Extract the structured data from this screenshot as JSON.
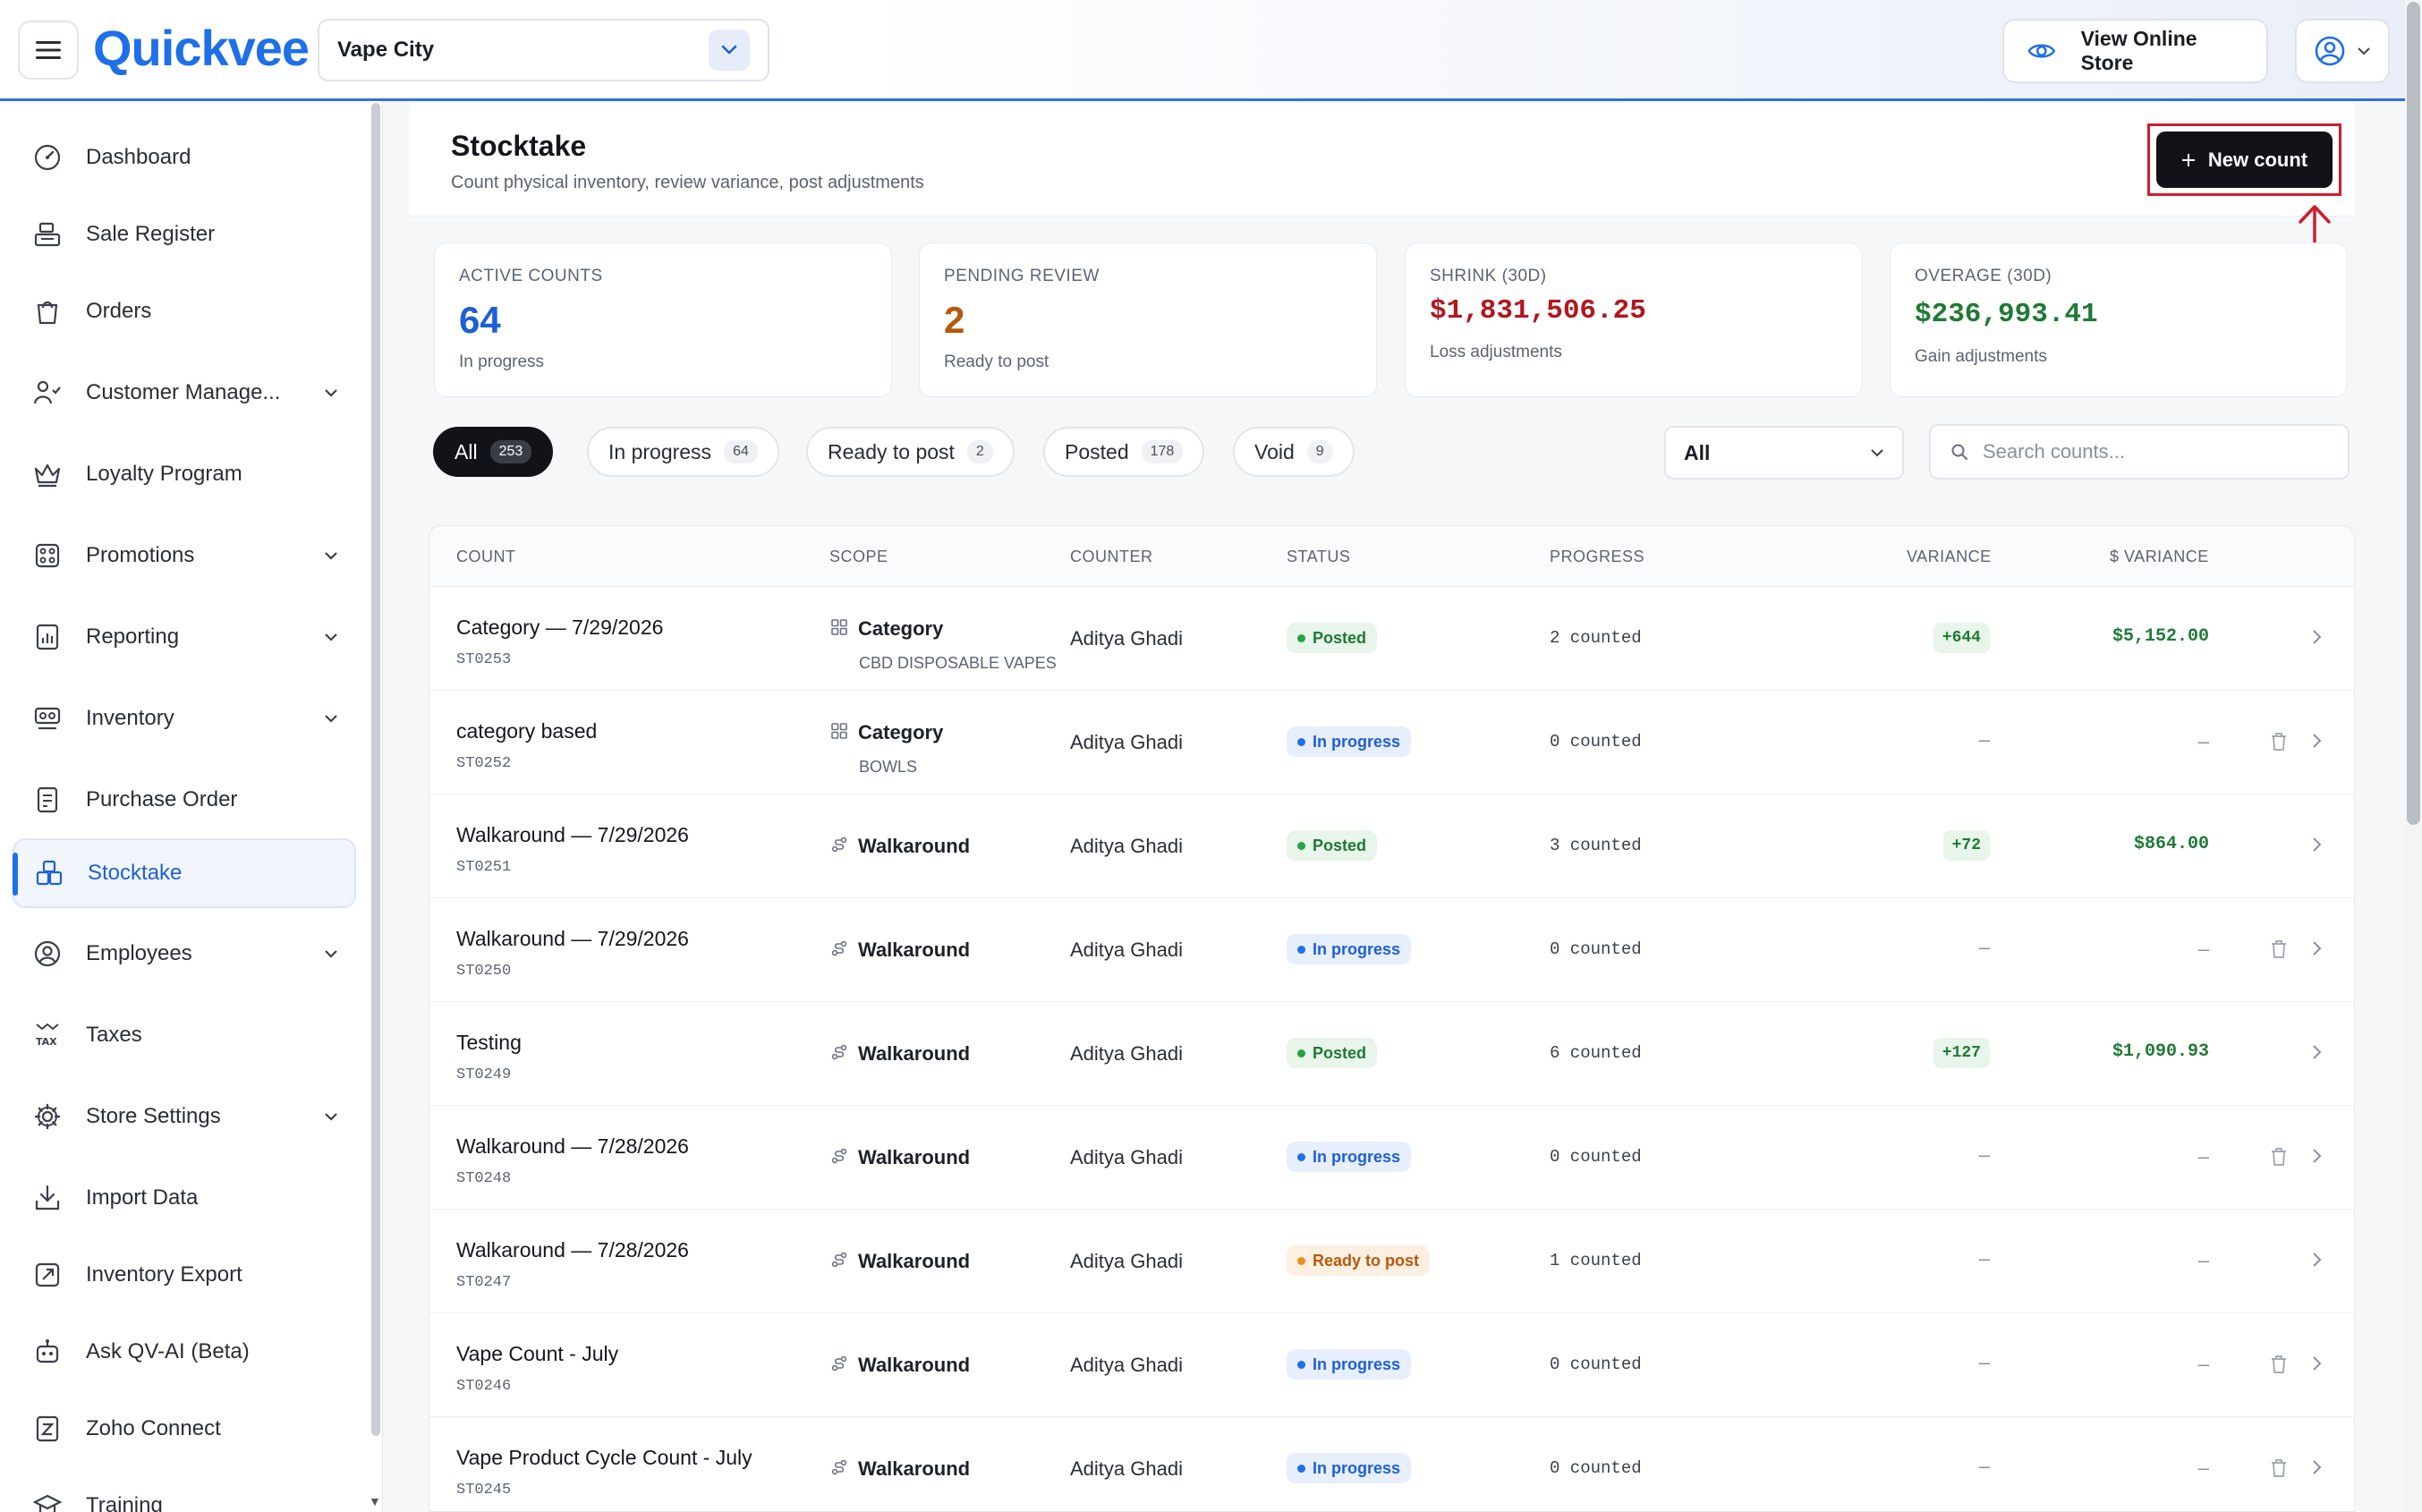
{
  "header": {
    "logo_text": "Quickvee",
    "store_name": "Vape City",
    "view_store_label": "View Online Store"
  },
  "sidebar": {
    "items": [
      {
        "label": "Dashboard",
        "icon": "dashboard-gauge-icon",
        "has_chevron": false
      },
      {
        "label": "Sale Register",
        "icon": "register-icon",
        "has_chevron": false
      },
      {
        "label": "Orders",
        "icon": "shopping-bag-icon",
        "has_chevron": false
      },
      {
        "label": "Customer Manage...",
        "icon": "customers-icon",
        "has_chevron": true
      },
      {
        "label": "Loyalty Program",
        "icon": "crown-icon",
        "has_chevron": false
      },
      {
        "label": "Promotions",
        "icon": "promotions-icon",
        "has_chevron": true
      },
      {
        "label": "Reporting",
        "icon": "report-chart-icon",
        "has_chevron": true
      },
      {
        "label": "Inventory",
        "icon": "inventory-icon",
        "has_chevron": true
      },
      {
        "label": "Purchase Order",
        "icon": "purchase-order-icon",
        "has_chevron": false
      },
      {
        "label": "Stocktake",
        "icon": "stocktake-icon",
        "has_chevron": false,
        "active": true
      },
      {
        "label": "Employees",
        "icon": "employee-icon",
        "has_chevron": true
      },
      {
        "label": "Taxes",
        "icon": "tax-icon",
        "has_chevron": false
      },
      {
        "label": "Store Settings",
        "icon": "gear-icon",
        "has_chevron": true
      },
      {
        "label": "Import Data",
        "icon": "import-icon",
        "has_chevron": false
      },
      {
        "label": "Inventory Export",
        "icon": "export-icon",
        "has_chevron": false
      },
      {
        "label": "Ask QV-AI (Beta)",
        "icon": "robot-icon",
        "has_chevron": false
      },
      {
        "label": "Zoho Connect",
        "icon": "zoho-icon",
        "has_chevron": false
      },
      {
        "label": "Training",
        "icon": "training-icon",
        "has_chevron": false
      }
    ]
  },
  "page": {
    "title": "Stocktake",
    "subtitle": "Count physical inventory, review variance, post adjustments",
    "new_count_label": "New count"
  },
  "stats": [
    {
      "label": "ACTIVE COUNTS",
      "value": "64",
      "sub": "In progress",
      "color": "#1f5fd6"
    },
    {
      "label": "PENDING REVIEW",
      "value": "2",
      "sub": "Ready to post",
      "color": "#b8580e"
    },
    {
      "label": "SHRINK (30D)",
      "value": "$1,831,506.25",
      "sub": "Loss adjustments",
      "color": "#b3161f"
    },
    {
      "label": "OVERAGE (30D)",
      "value": "$236,993.41",
      "sub": "Gain adjustments",
      "color": "#1f7a35"
    }
  ],
  "filters": {
    "chips": [
      {
        "label": "All",
        "count": "253",
        "active": true
      },
      {
        "label": "In progress",
        "count": "64"
      },
      {
        "label": "Ready to post",
        "count": "2"
      },
      {
        "label": "Posted",
        "count": "178"
      },
      {
        "label": "Void",
        "count": "9"
      }
    ],
    "select_value": "All",
    "search_placeholder": "Search counts..."
  },
  "table": {
    "columns": [
      "COUNT",
      "SCOPE",
      "COUNTER",
      "STATUS",
      "PROGRESS",
      "VARIANCE",
      "$ VARIANCE"
    ],
    "rows": [
      {
        "name": "Category — 7/29/2026",
        "id": "ST0253",
        "scope": "Category",
        "scope_sub": "CBD DISPOSABLE VAPES",
        "scope_icon": "grid-icon",
        "counter": "Aditya Ghadi",
        "status": "Posted",
        "status_kind": "posted",
        "progress": "2 counted",
        "variance": "+644",
        "dollar_variance": "$5,152.00",
        "deletable": false
      },
      {
        "name": "category based",
        "id": "ST0252",
        "scope": "Category",
        "scope_sub": "BOWLS",
        "scope_icon": "grid-icon",
        "counter": "Aditya Ghadi",
        "status": "In progress",
        "status_kind": "inprogress",
        "progress": "0 counted",
        "variance": "–",
        "dollar_variance": "–",
        "deletable": true
      },
      {
        "name": "Walkaround — 7/29/2026",
        "id": "ST0251",
        "scope": "Walkaround",
        "scope_sub": "",
        "scope_icon": "route-icon",
        "counter": "Aditya Ghadi",
        "status": "Posted",
        "status_kind": "posted",
        "progress": "3 counted",
        "variance": "+72",
        "dollar_variance": "$864.00",
        "deletable": false
      },
      {
        "name": "Walkaround — 7/29/2026",
        "id": "ST0250",
        "scope": "Walkaround",
        "scope_sub": "",
        "scope_icon": "route-icon",
        "counter": "Aditya Ghadi",
        "status": "In progress",
        "status_kind": "inprogress",
        "progress": "0 counted",
        "variance": "–",
        "dollar_variance": "–",
        "deletable": true
      },
      {
        "name": "Testing",
        "id": "ST0249",
        "scope": "Walkaround",
        "scope_sub": "",
        "scope_icon": "route-icon",
        "counter": "Aditya Ghadi",
        "status": "Posted",
        "status_kind": "posted",
        "progress": "6 counted",
        "variance": "+127",
        "dollar_variance": "$1,090.93",
        "deletable": false
      },
      {
        "name": "Walkaround — 7/28/2026",
        "id": "ST0248",
        "scope": "Walkaround",
        "scope_sub": "",
        "scope_icon": "route-icon",
        "counter": "Aditya Ghadi",
        "status": "In progress",
        "status_kind": "inprogress",
        "progress": "0 counted",
        "variance": "–",
        "dollar_variance": "–",
        "deletable": true
      },
      {
        "name": "Walkaround — 7/28/2026",
        "id": "ST0247",
        "scope": "Walkaround",
        "scope_sub": "",
        "scope_icon": "route-icon",
        "counter": "Aditya Ghadi",
        "status": "Ready to post",
        "status_kind": "ready",
        "progress": "1 counted",
        "variance": "–",
        "dollar_variance": "–",
        "deletable": false
      },
      {
        "name": "Vape Count - July",
        "id": "ST0246",
        "scope": "Walkaround",
        "scope_sub": "",
        "scope_icon": "route-icon",
        "counter": "Aditya Ghadi",
        "status": "In progress",
        "status_kind": "inprogress",
        "progress": "0 counted",
        "variance": "–",
        "dollar_variance": "–",
        "deletable": true
      },
      {
        "name": "Vape Product Cycle Count - July",
        "id": "ST0245",
        "scope": "Walkaround",
        "scope_sub": "",
        "scope_icon": "route-icon",
        "counter": "Aditya Ghadi",
        "status": "In progress",
        "status_kind": "inprogress",
        "progress": "0 counted",
        "variance": "–",
        "dollar_variance": "–",
        "deletable": true
      }
    ]
  },
  "colors": {
    "accent": "#1f6fe8",
    "highlight_frame": "#d21c2e"
  }
}
